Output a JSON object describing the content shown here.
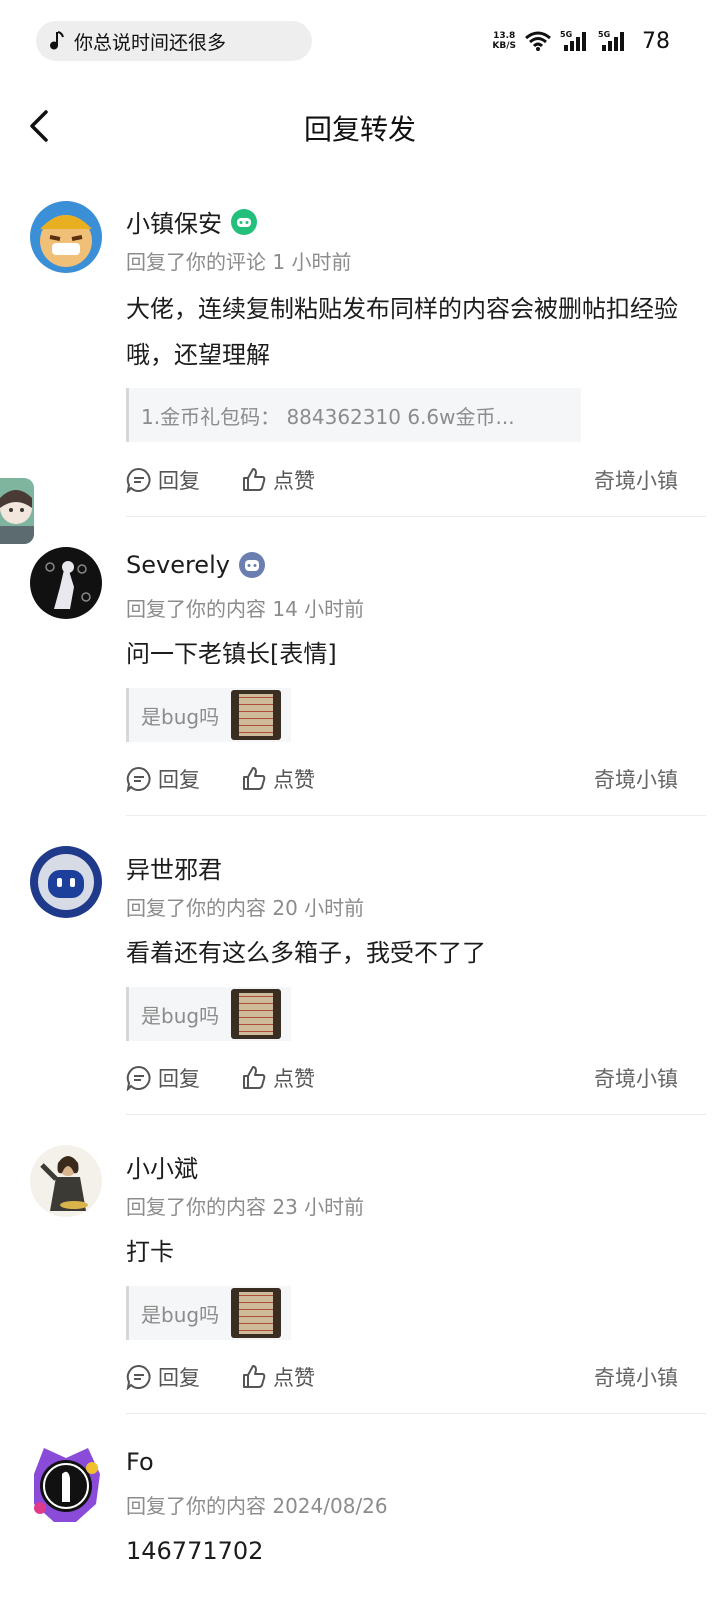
{
  "status_bar": {
    "song": "你总说时间还很多",
    "net_speed_value": "13.8",
    "net_speed_unit": "KB/S",
    "signal_1": "5G",
    "signal_2": "5G",
    "battery": "78"
  },
  "header": {
    "title": "回复转发"
  },
  "actions": {
    "reply": "回复",
    "like": "点赞"
  },
  "replies": [
    {
      "username": "小镇保安",
      "badge": "green-game-badge",
      "meta": "回复了你的评论 1 小时前",
      "text": "大佬，连续复制粘贴发布同样的内容会被删帖扣经验哦，还望理解",
      "quote": "1.金币礼包码： 884362310 6.6w金币...",
      "source": "奇境小镇"
    },
    {
      "username": "Severely",
      "badge": "gamepad-badge",
      "meta": "回复了你的内容 14 小时前",
      "text": "问一下老镇长[表情]",
      "quote": "是bug吗",
      "source": "奇境小镇"
    },
    {
      "username": "异世邪君",
      "meta": "回复了你的内容 20 小时前",
      "text": "看着还有这么多箱子，我受不了了",
      "quote": "是bug吗",
      "source": "奇境小镇"
    },
    {
      "username": "小小斌",
      "meta": "回复了你的内容 23 小时前",
      "text": "打卡",
      "quote": "是bug吗",
      "source": "奇境小镇"
    },
    {
      "username": "Fo",
      "meta": "回复了你的内容 2024/08/26",
      "text": "146771702"
    }
  ],
  "colors": {
    "text_primary": "#1c1c1c",
    "text_secondary": "#8c8c8c",
    "badge_green": "#22c07a",
    "badge_blue": "#6a7fb0"
  }
}
